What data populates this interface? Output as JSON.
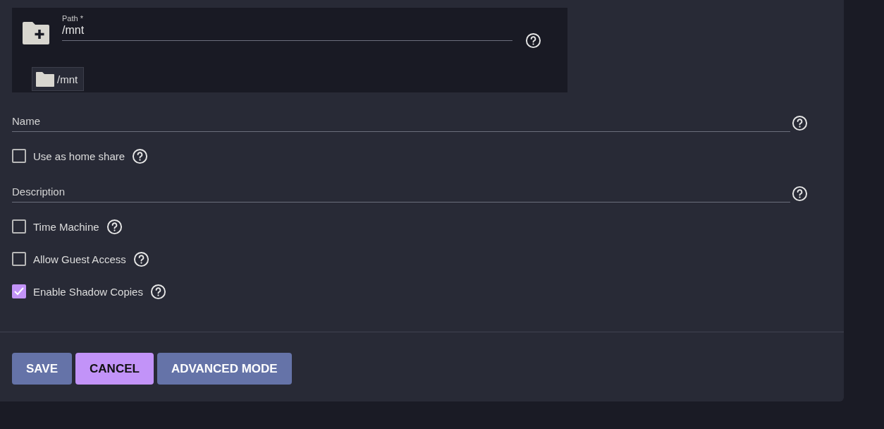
{
  "path_picker": {
    "label": "Path *",
    "value": "/mnt",
    "breadcrumb": "/mnt"
  },
  "form": [
    {
      "kind": "field",
      "placeholder": "Name"
    },
    {
      "kind": "checkbox",
      "label": "Use as home share",
      "checked": false
    },
    {
      "kind": "field",
      "placeholder": "Description"
    },
    {
      "kind": "checkbox",
      "label": "Time Machine",
      "checked": false
    },
    {
      "kind": "checkbox",
      "label": "Allow Guest Access",
      "checked": false
    },
    {
      "kind": "checkbox",
      "label": "Enable Shadow Copies",
      "checked": true
    }
  ],
  "buttons": [
    {
      "label": "SAVE",
      "kind": "primary"
    },
    {
      "label": "CANCEL",
      "kind": "accent"
    },
    {
      "label": "ADVANCED MODE",
      "kind": "primary"
    }
  ]
}
